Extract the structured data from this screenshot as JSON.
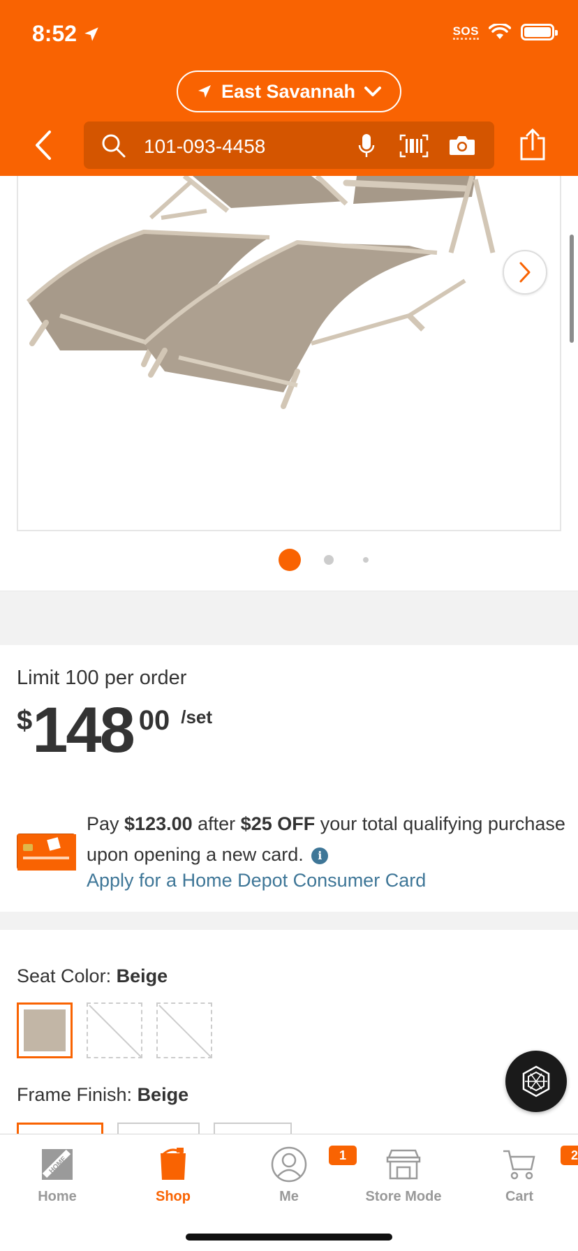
{
  "status_bar": {
    "time": "8:52",
    "sos": "SOS"
  },
  "header": {
    "location": "East Savannah",
    "search_value": "101-093-4458"
  },
  "carousel": {
    "active_index": 0,
    "total": 3
  },
  "product": {
    "limit_text": "Limit 100 per order",
    "price_currency": "$",
    "price_dollars": "148",
    "price_cents": "00",
    "price_unit": "/set"
  },
  "promo": {
    "pay_prefix": "Pay ",
    "pay_amount": "$123.00",
    "after_text": " after ",
    "discount": "$25 OFF",
    "rest_text": " your total qualifying purchase upon opening a new card.",
    "info_glyph": "i",
    "apply_link": "Apply for a Home Depot Consumer Card"
  },
  "options": {
    "seat_color_label": "Seat Color:",
    "seat_color_value": "Beige",
    "frame_finish_label": "Frame Finish:",
    "frame_finish_value": "Beige",
    "selected_swatch_color": "#c2b6a6"
  },
  "tabbar": {
    "tabs": [
      {
        "label": "Home",
        "icon": "home-depot-logo-icon"
      },
      {
        "label": "Shop",
        "icon": "bucket-icon",
        "active": true
      },
      {
        "label": "Me",
        "icon": "user-icon",
        "badge": "1"
      },
      {
        "label": "Store Mode",
        "icon": "store-icon"
      },
      {
        "label": "Cart",
        "icon": "cart-icon",
        "badge": "2"
      }
    ]
  },
  "colors": {
    "brand": "#f96302",
    "link": "#3e7697"
  }
}
